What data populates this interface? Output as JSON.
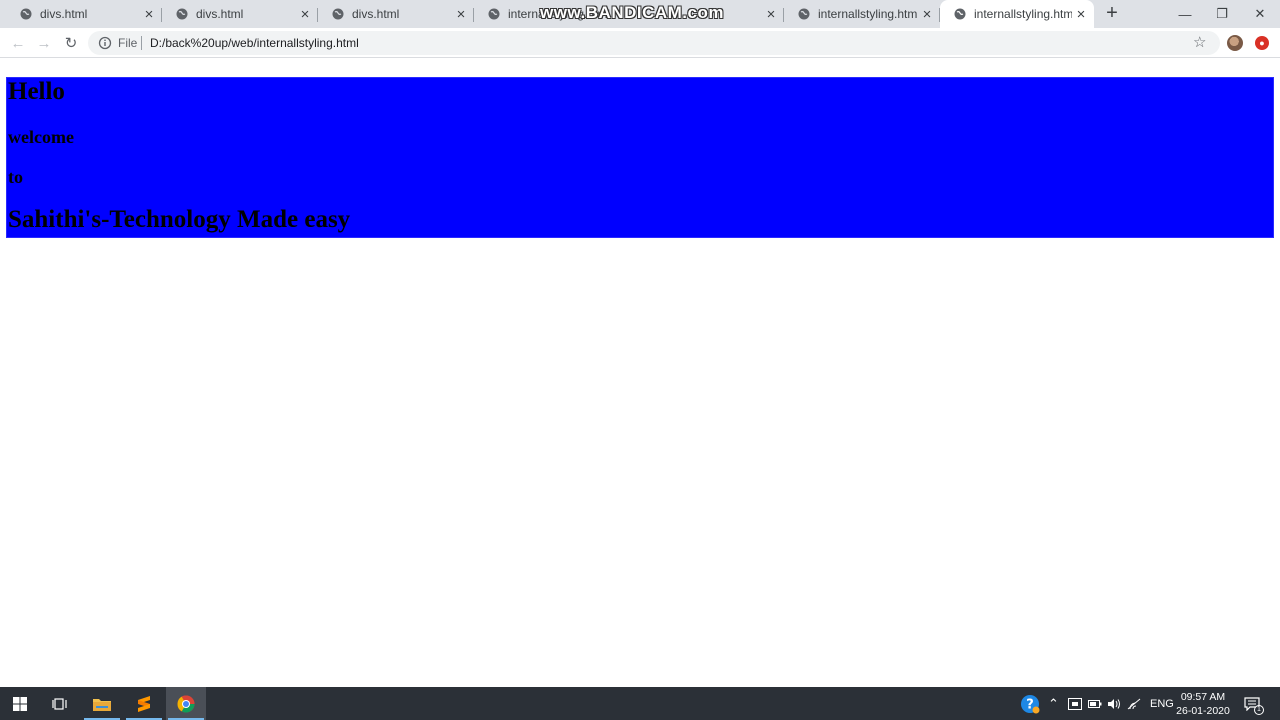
{
  "browser": {
    "tabs": [
      {
        "title": "divs.html",
        "active": false
      },
      {
        "title": "divs.html",
        "active": false
      },
      {
        "title": "divs.html",
        "active": false
      },
      {
        "title": "internallstyling.html",
        "active": false
      },
      {
        "title": "internallstyling.html",
        "active": false
      },
      {
        "title": "internallstyling.html",
        "active": true
      }
    ],
    "new_tab_glyph": "+",
    "window_controls": {
      "minimize": "—",
      "maximize": "❐",
      "close": "✕"
    },
    "watermark": "www.BANDICAM.com",
    "toolbar": {
      "back_glyph": "←",
      "forward_glyph": "→",
      "reload_glyph": "↻",
      "scheme_label": "File",
      "url": "D:/back%20up/web/internallstyling.html",
      "bookmark_glyph": "☆"
    }
  },
  "page": {
    "box_color": "#0000ff",
    "headings": {
      "h1": "Hello",
      "h2_first": "welcome",
      "h2_second": "to",
      "h1_second": "Sahithi's-Technology Made easy"
    }
  },
  "taskbar": {
    "language": "ENG",
    "time": "09:57 AM",
    "date": "26-01-2020",
    "notification_count": "1",
    "apps": [
      "windows-start",
      "task-view",
      "file-explorer",
      "sublime-text",
      "chrome"
    ],
    "active_app": "chrome"
  }
}
